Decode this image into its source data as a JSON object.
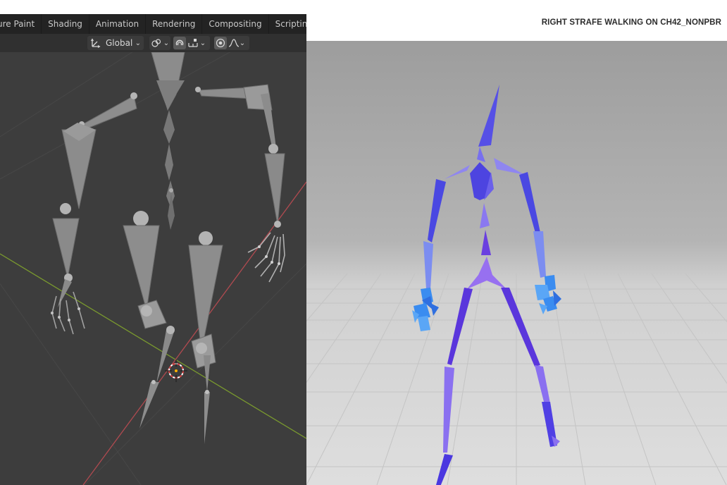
{
  "blender": {
    "workspace_tabs": [
      {
        "label": "ure Paint"
      },
      {
        "label": "Shading"
      },
      {
        "label": "Animation"
      },
      {
        "label": "Rendering"
      },
      {
        "label": "Compositing"
      },
      {
        "label": "Scripting"
      }
    ],
    "add_workspace_label": "+",
    "header": {
      "transform_orientation": "Global",
      "transform_orientation_icon": "orientation-axes-icon",
      "pivot_icon": "pivot-point-icon",
      "snap_icon": "snap-magnet-icon",
      "snap_target_icon": "snap-increment-icon",
      "proportional_icon": "proportional-edit-icon",
      "falloff_icon": "falloff-curve-icon"
    },
    "colors": {
      "viewport_bg": "#3d3d3d",
      "header_bg": "#303030",
      "tabs_bg": "#232323",
      "axis_x": "#b04a50",
      "axis_y": "#7a9a2e",
      "bone": "#8c8c8c"
    }
  },
  "preview": {
    "title": "RIGHT STRAFE WALKING ON CH42_NONPBR",
    "colors": {
      "skeleton_primary": "#5a4ee6",
      "skeleton_secondary": "#8a78f0",
      "hands": "#3a8cf0",
      "floor": "#d9d9d9",
      "backdrop": "#a6a6a6"
    }
  }
}
